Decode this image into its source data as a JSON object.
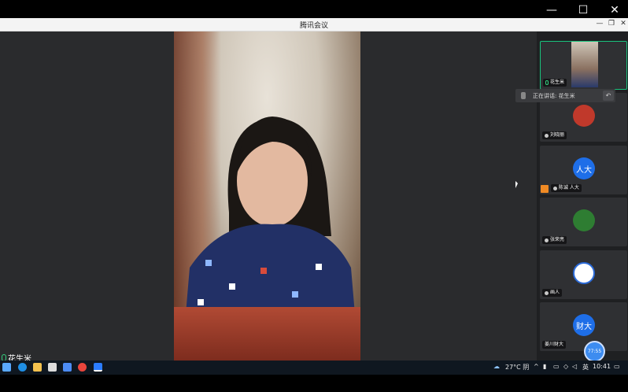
{
  "window": {
    "title": "腾讯会议",
    "min_glyph": "—",
    "max_glyph": "☐",
    "close_glyph": "✕",
    "app_min_glyph": "—",
    "app_restore_glyph": "❐",
    "app_close_glyph": "✕"
  },
  "main_video": {
    "speaker_name": "花生米"
  },
  "speaking_tip": {
    "text": "正在讲话: 花生米"
  },
  "participants": [
    {
      "name": "花生米",
      "avatar_type": "video"
    },
    {
      "name": "刘晓丽",
      "avatar_type": "image",
      "avatar_color": "#c0392b"
    },
    {
      "name": "陈诚 人大",
      "avatar_type": "text",
      "avatar_text": "人大",
      "avatar_color": "#1e6ee8"
    },
    {
      "name": "张荣亮",
      "avatar_type": "image",
      "avatar_color": "#2e7d32"
    },
    {
      "name": "画人",
      "avatar_type": "image",
      "avatar_color": "#ffffff"
    },
    {
      "name": "姜川财大",
      "avatar_type": "text",
      "avatar_text": "财大",
      "avatar_color": "#1e6ee8"
    }
  ],
  "timer_badge": "77:55",
  "taskbar": {
    "weather": "27°C 阴",
    "ime": "英",
    "time": "10:41"
  },
  "colors": {
    "stage_bg": "#2a2b2d",
    "active_border": "#19c37d",
    "accent": "#1e6ee8"
  }
}
